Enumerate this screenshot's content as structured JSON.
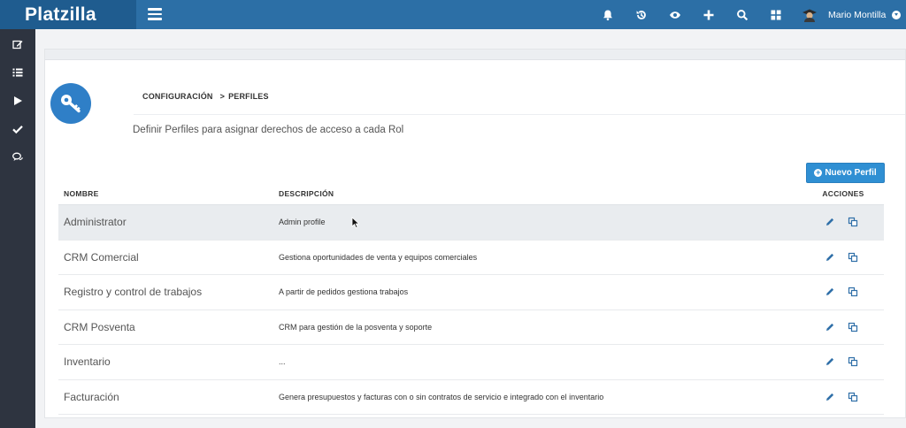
{
  "header": {
    "brand": "Platzilla",
    "icons": [
      "bell-icon",
      "history-icon",
      "eye-icon",
      "plus-icon",
      "search-icon",
      "grid-icon"
    ],
    "user_name": "Mario Montilla",
    "colors": {
      "topbar": "#2c6fa6",
      "brand_bg": "#1f5c8f",
      "sidebar": "#2e3440",
      "accent": "#2f8fd3"
    }
  },
  "sidebar": {
    "items": [
      "edit-icon",
      "list-icon",
      "play-icon",
      "check-icon",
      "comments-icon"
    ]
  },
  "page": {
    "breadcrumb": [
      "CONFIGURACIÓN",
      "PERFILES"
    ],
    "breadcrumb_separator": ">",
    "subtitle": "Definir Perfiles para asignar derechos de acceso a cada Rol",
    "new_button": "Nuevo Perfil"
  },
  "table": {
    "headers": {
      "name": "NOMBRE",
      "description": "DESCRIPCIÓN",
      "actions": "ACCIONES"
    },
    "rows": [
      {
        "name": "Administrator",
        "description": "Admin profile"
      },
      {
        "name": "CRM Comercial",
        "description": "Gestiona oportunidades de venta y equipos comerciales"
      },
      {
        "name": "Registro y control de trabajos",
        "description": "A partir de pedidos gestiona trabajos"
      },
      {
        "name": "CRM Posventa",
        "description": "CRM para gestión de la posventa y soporte"
      },
      {
        "name": "Inventario",
        "description": "..."
      },
      {
        "name": "Facturación",
        "description": "Genera presupuestos y facturas con o sin contratos de servicio e integrado con el inventario"
      }
    ]
  }
}
